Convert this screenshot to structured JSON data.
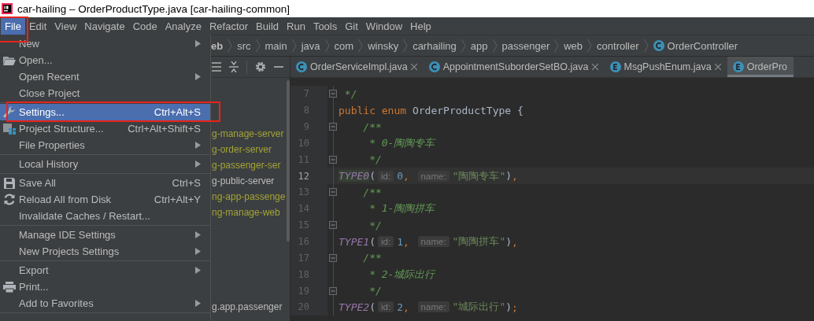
{
  "window": {
    "title": "car-hailing – OrderProductType.java [car-hailing-common]"
  },
  "menu_bar": [
    {
      "label": "File",
      "selected": true,
      "highlight": true
    },
    {
      "label": "Edit",
      "selected": false,
      "highlight": false
    },
    {
      "label": "View",
      "selected": false,
      "highlight": false
    },
    {
      "label": "Navigate",
      "selected": false,
      "highlight": false
    },
    {
      "label": "Code",
      "selected": false,
      "highlight": false
    },
    {
      "label": "Analyze",
      "selected": false,
      "highlight": false
    },
    {
      "label": "Refactor",
      "selected": false,
      "highlight": false
    },
    {
      "label": "Build",
      "selected": false,
      "highlight": false
    },
    {
      "label": "Run",
      "selected": false,
      "highlight": false
    },
    {
      "label": "Tools",
      "selected": false,
      "highlight": false
    },
    {
      "label": "Git",
      "selected": false,
      "highlight": false
    },
    {
      "label": "Window",
      "selected": false,
      "highlight": false
    },
    {
      "label": "Help",
      "selected": false,
      "highlight": false
    }
  ],
  "file_menu": [
    {
      "kind": "item",
      "label": "New",
      "submenu": true,
      "selected": false,
      "highlight": false
    },
    {
      "kind": "item",
      "label": "Open...",
      "submenu": false,
      "selected": false,
      "highlight": false
    },
    {
      "kind": "item",
      "label": "Open Recent",
      "submenu": true,
      "selected": false,
      "highlight": false
    },
    {
      "kind": "item",
      "label": "Close Project",
      "submenu": false,
      "selected": false,
      "highlight": false
    },
    {
      "kind": "separator"
    },
    {
      "kind": "item",
      "label": "Settings...",
      "shortcut": "Ctrl+Alt+S",
      "submenu": false,
      "selected": true,
      "highlight": true
    },
    {
      "kind": "item",
      "label": "Project Structure...",
      "shortcut": "Ctrl+Alt+Shift+S",
      "submenu": false,
      "selected": false,
      "highlight": false
    },
    {
      "kind": "item",
      "label": "File Properties",
      "submenu": true,
      "selected": false,
      "highlight": false
    },
    {
      "kind": "separator"
    },
    {
      "kind": "item",
      "label": "Local History",
      "submenu": true,
      "selected": false,
      "highlight": false
    },
    {
      "kind": "separator"
    },
    {
      "kind": "item",
      "label": "Save All",
      "shortcut": "Ctrl+S",
      "submenu": false,
      "selected": false,
      "highlight": false
    },
    {
      "kind": "item",
      "label": "Reload All from Disk",
      "shortcut": "Ctrl+Alt+Y",
      "submenu": false,
      "selected": false,
      "highlight": false
    },
    {
      "kind": "item",
      "label": "Invalidate Caches / Restart...",
      "submenu": false,
      "selected": false,
      "highlight": false
    },
    {
      "kind": "separator"
    },
    {
      "kind": "item",
      "label": "Manage IDE Settings",
      "submenu": true,
      "selected": false,
      "highlight": false
    },
    {
      "kind": "item",
      "label": "New Projects Settings",
      "submenu": true,
      "selected": false,
      "highlight": false
    },
    {
      "kind": "separator"
    },
    {
      "kind": "item",
      "label": "Export",
      "submenu": true,
      "selected": false,
      "highlight": false
    },
    {
      "kind": "item",
      "label": "Print...",
      "submenu": false,
      "selected": false,
      "highlight": false
    },
    {
      "kind": "item",
      "label": "Add to Favorites",
      "submenu": true,
      "selected": false,
      "highlight": false
    },
    {
      "kind": "separator"
    }
  ],
  "breadcrumbs": [
    {
      "label": "eb",
      "kind": "folder"
    },
    {
      "label": "src",
      "kind": "folder"
    },
    {
      "label": "main",
      "kind": "folder"
    },
    {
      "label": "java",
      "kind": "folder"
    },
    {
      "label": "com",
      "kind": "folder"
    },
    {
      "label": "winsky",
      "kind": "folder"
    },
    {
      "label": "carhailing",
      "kind": "folder"
    },
    {
      "label": "app",
      "kind": "folder"
    },
    {
      "label": "passenger",
      "kind": "folder"
    },
    {
      "label": "web",
      "kind": "folder"
    },
    {
      "label": "controller",
      "kind": "folder"
    },
    {
      "label": "OrderController",
      "kind": "class"
    }
  ],
  "project_tree": [
    {
      "label": "g-manage-server",
      "kind": "module"
    },
    {
      "label": "g-order-server",
      "kind": "module"
    },
    {
      "label": "g-passenger-ser",
      "kind": "module"
    },
    {
      "label": "g-public-server",
      "kind": "plain"
    },
    {
      "label": "ng-app-passenge",
      "kind": "module"
    },
    {
      "label": "ng-manage-web",
      "kind": "module"
    },
    {
      "label": "g.app.passenger",
      "kind": "plain"
    }
  ],
  "editor_tabs": [
    {
      "label": "OrderServiceImpl.java",
      "kind": "class",
      "selected": false
    },
    {
      "label": "AppointmentSuborderSetBO.java",
      "kind": "class",
      "selected": false
    },
    {
      "label": "MsgPushEnum.java",
      "kind": "enum",
      "selected": false
    },
    {
      "label": "OrderPro",
      "kind": "enum",
      "selected": true
    }
  ],
  "code": [
    {
      "number": "7",
      "fold": true,
      "current": false,
      "tokens": [
        {
          "kind": "comment",
          "text": " */"
        }
      ]
    },
    {
      "number": "8",
      "fold": false,
      "current": false,
      "tokens": [
        {
          "kind": "keyword",
          "text": "public enum "
        },
        {
          "kind": "type",
          "text": "OrderProductType "
        },
        {
          "kind": "punct",
          "text": "{"
        }
      ]
    },
    {
      "number": "9",
      "fold": true,
      "current": false,
      "tokens": [
        {
          "kind": "comment",
          "text": "    /**"
        }
      ]
    },
    {
      "number": "10",
      "fold": false,
      "current": false,
      "tokens": [
        {
          "kind": "comment",
          "text": "     * 0-陶陶专车"
        }
      ]
    },
    {
      "number": "11",
      "fold": true,
      "current": false,
      "tokens": [
        {
          "kind": "comment",
          "text": "     */"
        }
      ]
    },
    {
      "number": "12",
      "fold": false,
      "current": true,
      "tokens": [
        {
          "kind": "enum",
          "text": "TYPE0",
          "usage": true
        },
        {
          "kind": "punct",
          "text": "("
        },
        {
          "kind": "hint",
          "text": "id:"
        },
        {
          "kind": "number",
          "text": "0"
        },
        {
          "kind": "keyword",
          "text": ","
        },
        {
          "kind": "hint",
          "text": "name:"
        },
        {
          "kind": "string",
          "text": "\"陶陶专车\""
        },
        {
          "kind": "punct",
          "text": ")"
        },
        {
          "kind": "keyword",
          "text": ","
        }
      ]
    },
    {
      "number": "13",
      "fold": true,
      "current": false,
      "tokens": [
        {
          "kind": "comment",
          "text": "    /**"
        }
      ]
    },
    {
      "number": "14",
      "fold": false,
      "current": false,
      "tokens": [
        {
          "kind": "comment",
          "text": "     * 1-陶陶拼车"
        }
      ]
    },
    {
      "number": "15",
      "fold": true,
      "current": false,
      "tokens": [
        {
          "kind": "comment",
          "text": "     */"
        }
      ]
    },
    {
      "number": "16",
      "fold": false,
      "current": false,
      "tokens": [
        {
          "kind": "enum",
          "text": "TYPE1",
          "usage": false
        },
        {
          "kind": "punct",
          "text": "("
        },
        {
          "kind": "hint",
          "text": "id:"
        },
        {
          "kind": "number",
          "text": "1"
        },
        {
          "kind": "keyword",
          "text": ","
        },
        {
          "kind": "hint",
          "text": "name:"
        },
        {
          "kind": "string",
          "text": "\"陶陶拼车\""
        },
        {
          "kind": "punct",
          "text": ")"
        },
        {
          "kind": "keyword",
          "text": ","
        }
      ]
    },
    {
      "number": "17",
      "fold": true,
      "current": false,
      "tokens": [
        {
          "kind": "comment",
          "text": "    /**"
        }
      ]
    },
    {
      "number": "18",
      "fold": false,
      "current": false,
      "tokens": [
        {
          "kind": "comment",
          "text": "     * 2-城际出行"
        }
      ]
    },
    {
      "number": "19",
      "fold": true,
      "current": false,
      "tokens": [
        {
          "kind": "comment",
          "text": "     */"
        }
      ]
    },
    {
      "number": "20",
      "fold": false,
      "current": false,
      "tokens": [
        {
          "kind": "enum",
          "text": "TYPE2",
          "usage": false
        },
        {
          "kind": "punct",
          "text": "("
        },
        {
          "kind": "hint",
          "text": "id:"
        },
        {
          "kind": "number",
          "text": "2"
        },
        {
          "kind": "keyword",
          "text": ","
        },
        {
          "kind": "hint",
          "text": "name:"
        },
        {
          "kind": "string",
          "text": "\"城际出行\""
        },
        {
          "kind": "punct",
          "text": ")"
        },
        {
          "kind": "keyword",
          "text": ";"
        }
      ]
    }
  ]
}
